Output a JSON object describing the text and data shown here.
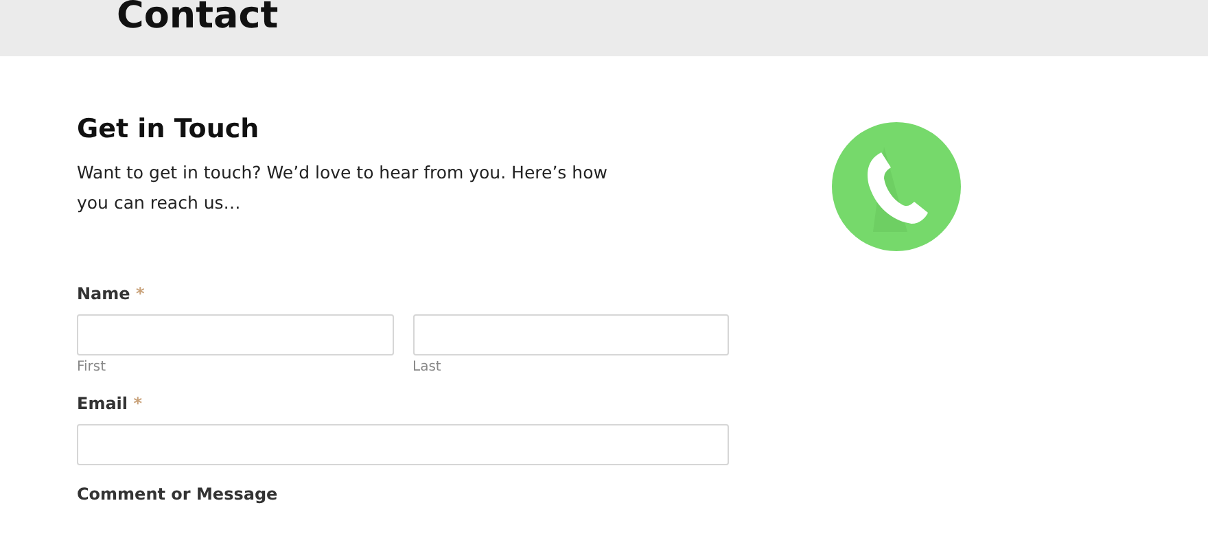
{
  "page_title": "Contact",
  "intro": {
    "heading": "Get in Touch",
    "text": "Want to get in touch? We’d love to hear from you. Here’s how you can reach us…"
  },
  "form": {
    "fields": [
      {
        "kind": "name",
        "label": "Name",
        "required_mark": "*",
        "parts": [
          {
            "sublabel": "First"
          },
          {
            "sublabel": "Last"
          }
        ]
      },
      {
        "kind": "email",
        "label": "Email",
        "required_mark": "*"
      },
      {
        "kind": "label_only",
        "label": "Comment or Message"
      }
    ]
  }
}
